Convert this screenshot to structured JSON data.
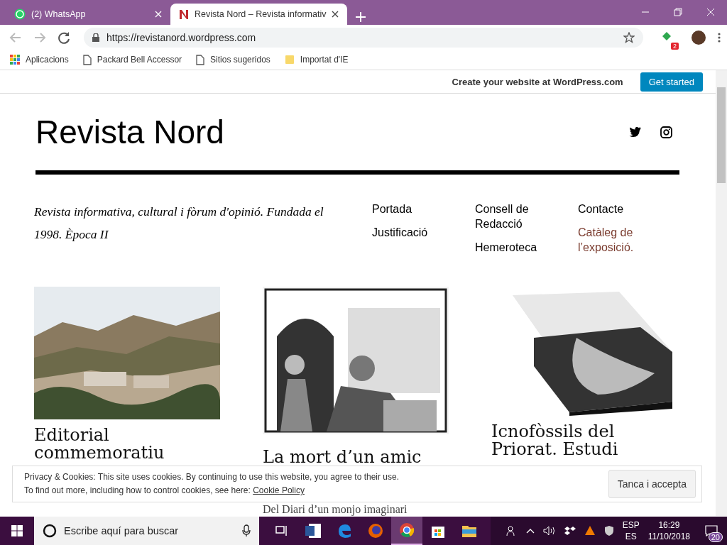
{
  "browser": {
    "tabs": [
      {
        "label": "(2) WhatsApp",
        "selected": false
      },
      {
        "label": "Revista Nord – Revista informativ",
        "selected": true
      }
    ],
    "url": "https://revistanord.wordpress.com",
    "extension_badge": "2",
    "bookmarks": [
      {
        "label": "Aplicacions",
        "kind": "apps"
      },
      {
        "label": "Packard Bell Accessor",
        "kind": "page"
      },
      {
        "label": "Sitios sugeridos",
        "kind": "page"
      },
      {
        "label": "Importat d'IE",
        "kind": "folder"
      }
    ]
  },
  "wp_bar": {
    "text": "Create your website at WordPress.com",
    "button": "Get started"
  },
  "site": {
    "title": "Revista Nord",
    "tagline": "Revista informativa, cultural i fòrum d'opinió. Fundada el 1998. Època II",
    "menu": [
      [
        {
          "label": "Portada",
          "current": false
        },
        {
          "label": "Justificació",
          "current": false
        }
      ],
      [
        {
          "label": "Consell de Redacció",
          "current": false
        },
        {
          "label": "Hemeroteca",
          "current": false
        }
      ],
      [
        {
          "label": "Contacte",
          "current": false
        },
        {
          "label": "Catàleg de l’exposició.",
          "current": true
        }
      ]
    ]
  },
  "posts": [
    {
      "title": "Editorial commemoratiu"
    },
    {
      "title": "La mort d’un amic",
      "excerpt": "Del Diari d’un monjo imaginari"
    },
    {
      "title": "Icnofòssils del Priorat. Estudi"
    }
  ],
  "cookie_bar": {
    "line_1": "Privacy & Cookies: This site uses cookies. By continuing to use this website, you agree to their use.",
    "line_2": "To find out more, including how to control cookies, see here:",
    "link": "Cookie Policy",
    "button": "Tanca i accepta"
  },
  "taskbar": {
    "search_placeholder": "Escribe aquí para buscar",
    "apps": [
      {
        "kind": "taskview",
        "active": false
      },
      {
        "kind": "word",
        "active": false
      },
      {
        "kind": "edge",
        "active": false
      },
      {
        "kind": "firefox",
        "active": false
      },
      {
        "kind": "chrome",
        "active": true
      },
      {
        "kind": "store",
        "active": false
      },
      {
        "kind": "explorer",
        "active": false
      }
    ],
    "language_1": "ESP",
    "language_2": "ES",
    "time": "16:29",
    "date": "11/10/2018",
    "notifications": "20"
  }
}
